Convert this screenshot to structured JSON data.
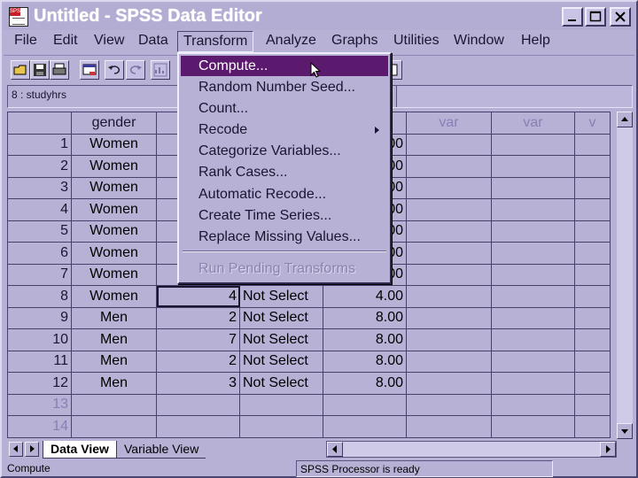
{
  "window": {
    "title": "Untitled - SPSS Data Editor",
    "app_icon_tag": "SPSS"
  },
  "menubar": {
    "items": [
      {
        "label": "File"
      },
      {
        "label": "Edit"
      },
      {
        "label": "View"
      },
      {
        "label": "Data"
      },
      {
        "label": "Transform"
      },
      {
        "label": "Analyze"
      },
      {
        "label": "Graphs"
      },
      {
        "label": "Utilities"
      },
      {
        "label": "Window"
      },
      {
        "label": "Help"
      }
    ],
    "active": "Transform"
  },
  "toolbar": {
    "icons": [
      "open-file-icon",
      "save-icon",
      "print-icon",
      "dialog-recall-icon",
      "undo-icon",
      "redo-icon",
      "goto-chart-icon"
    ]
  },
  "cellbar": {
    "cell_ref": "8 : studyhrs",
    "cell_value": ""
  },
  "grid": {
    "columns": [
      "gender",
      "s",
      "",
      "",
      "var",
      "var",
      "v"
    ],
    "rows": [
      {
        "num": "1",
        "gender": "Women",
        "c2": "",
        "c3": "",
        "c4": "00"
      },
      {
        "num": "2",
        "gender": "Women",
        "c2": "",
        "c3": "",
        "c4": "00"
      },
      {
        "num": "3",
        "gender": "Women",
        "c2": "",
        "c3": "",
        "c4": "00"
      },
      {
        "num": "4",
        "gender": "Women",
        "c2": "",
        "c3": "",
        "c4": "00"
      },
      {
        "num": "5",
        "gender": "Women",
        "c2": "",
        "c3": "",
        "c4": "00"
      },
      {
        "num": "6",
        "gender": "Women",
        "c2": "",
        "c3": "",
        "c4": "00"
      },
      {
        "num": "7",
        "gender": "Women",
        "c2": "",
        "c3": "",
        "c4": "00"
      },
      {
        "num": "8",
        "gender": "Women",
        "c2": "4",
        "c3": "Not Select",
        "c4": "4.00"
      },
      {
        "num": "9",
        "gender": "Men",
        "c2": "2",
        "c3": "Not Select",
        "c4": "8.00"
      },
      {
        "num": "10",
        "gender": "Men",
        "c2": "7",
        "c3": "Not Select",
        "c4": "8.00"
      },
      {
        "num": "11",
        "gender": "Men",
        "c2": "2",
        "c3": "Not Select",
        "c4": "8.00"
      },
      {
        "num": "12",
        "gender": "Men",
        "c2": "3",
        "c3": "Not Select",
        "c4": "8.00"
      },
      {
        "num": "13",
        "gender": "",
        "c2": "",
        "c3": "",
        "c4": ""
      },
      {
        "num": "14",
        "gender": "",
        "c2": "",
        "c3": "",
        "c4": ""
      }
    ]
  },
  "tabs": {
    "data_view": "Data View",
    "variable_view": "Variable View"
  },
  "statusbar": {
    "left": "Compute",
    "processor": "SPSS Processor  is ready"
  },
  "transform_menu": {
    "items": [
      {
        "label": "Compute...",
        "highlighted": true
      },
      {
        "label": "Random Number Seed..."
      },
      {
        "label": "Count..."
      },
      {
        "label": "Recode",
        "submenu": true
      },
      {
        "label": "Categorize Variables..."
      },
      {
        "label": "Rank Cases..."
      },
      {
        "label": "Automatic Recode..."
      },
      {
        "label": "Create Time Series..."
      },
      {
        "label": "Replace Missing Values..."
      },
      {
        "label": "Run Pending Transforms",
        "disabled": true
      }
    ]
  },
  "colors": {
    "window_bg": "#b7b1d6",
    "menu_highlight": "#5b1a6e",
    "title_text": "#ffffff"
  }
}
